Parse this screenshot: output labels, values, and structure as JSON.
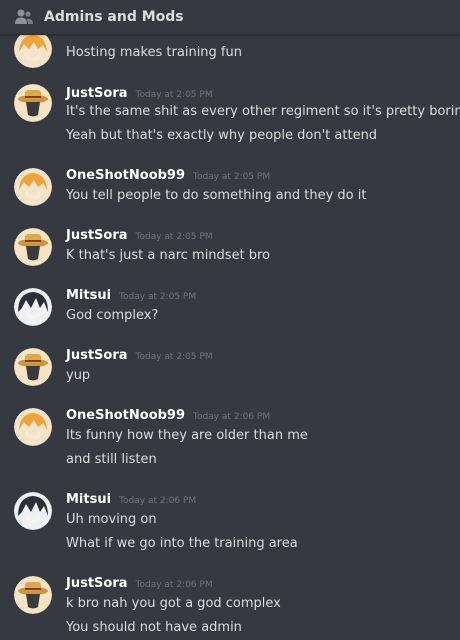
{
  "header": {
    "title": "Admins and Mods",
    "icon": "people-icon"
  },
  "colors": {
    "background": "#36393f",
    "username": "#ffffff",
    "timestamp": "#72767d",
    "text": "#dcddde"
  },
  "messages": [
    {
      "author": "",
      "timestamp": "",
      "avatar": "orange-hair-avatar",
      "lines": [
        "Hosting makes training fun"
      ]
    },
    {
      "author": "JustSora",
      "timestamp": "Today at 2:05 PM",
      "avatar": "straw-hat-avatar",
      "lines": [
        "It's the same shit as every other regiment so it's pretty boring",
        "Yeah but that's exactly why people don't attend"
      ]
    },
    {
      "author": "OneShotNoob99",
      "timestamp": "Today at 2:05 PM",
      "avatar": "orange-hair-avatar",
      "lines": [
        "You tell people to do something and they do it"
      ]
    },
    {
      "author": "JustSora",
      "timestamp": "Today at 2:05 PM",
      "avatar": "straw-hat-avatar",
      "lines": [
        "K that's just a narc mindset bro"
      ]
    },
    {
      "author": "Mitsui",
      "timestamp": "Today at 2:05 PM",
      "avatar": "dark-hair-avatar",
      "lines": [
        "God complex?"
      ]
    },
    {
      "author": "JustSora",
      "timestamp": "Today at 2:05 PM",
      "avatar": "straw-hat-avatar",
      "lines": [
        "yup"
      ]
    },
    {
      "author": "OneShotNoob99",
      "timestamp": "Today at 2:06 PM",
      "avatar": "orange-hair-avatar",
      "lines": [
        "Its funny how they are older than me",
        "and still listen"
      ]
    },
    {
      "author": "Mitsui",
      "timestamp": "Today at 2:06 PM",
      "avatar": "dark-hair-avatar",
      "lines": [
        "Uh moving on",
        "What if we go into the training area"
      ]
    },
    {
      "author": "JustSora",
      "timestamp": "Today at 2:06 PM",
      "avatar": "straw-hat-avatar",
      "lines": [
        "k bro nah you got a god complex",
        "You should not have admin"
      ]
    }
  ]
}
